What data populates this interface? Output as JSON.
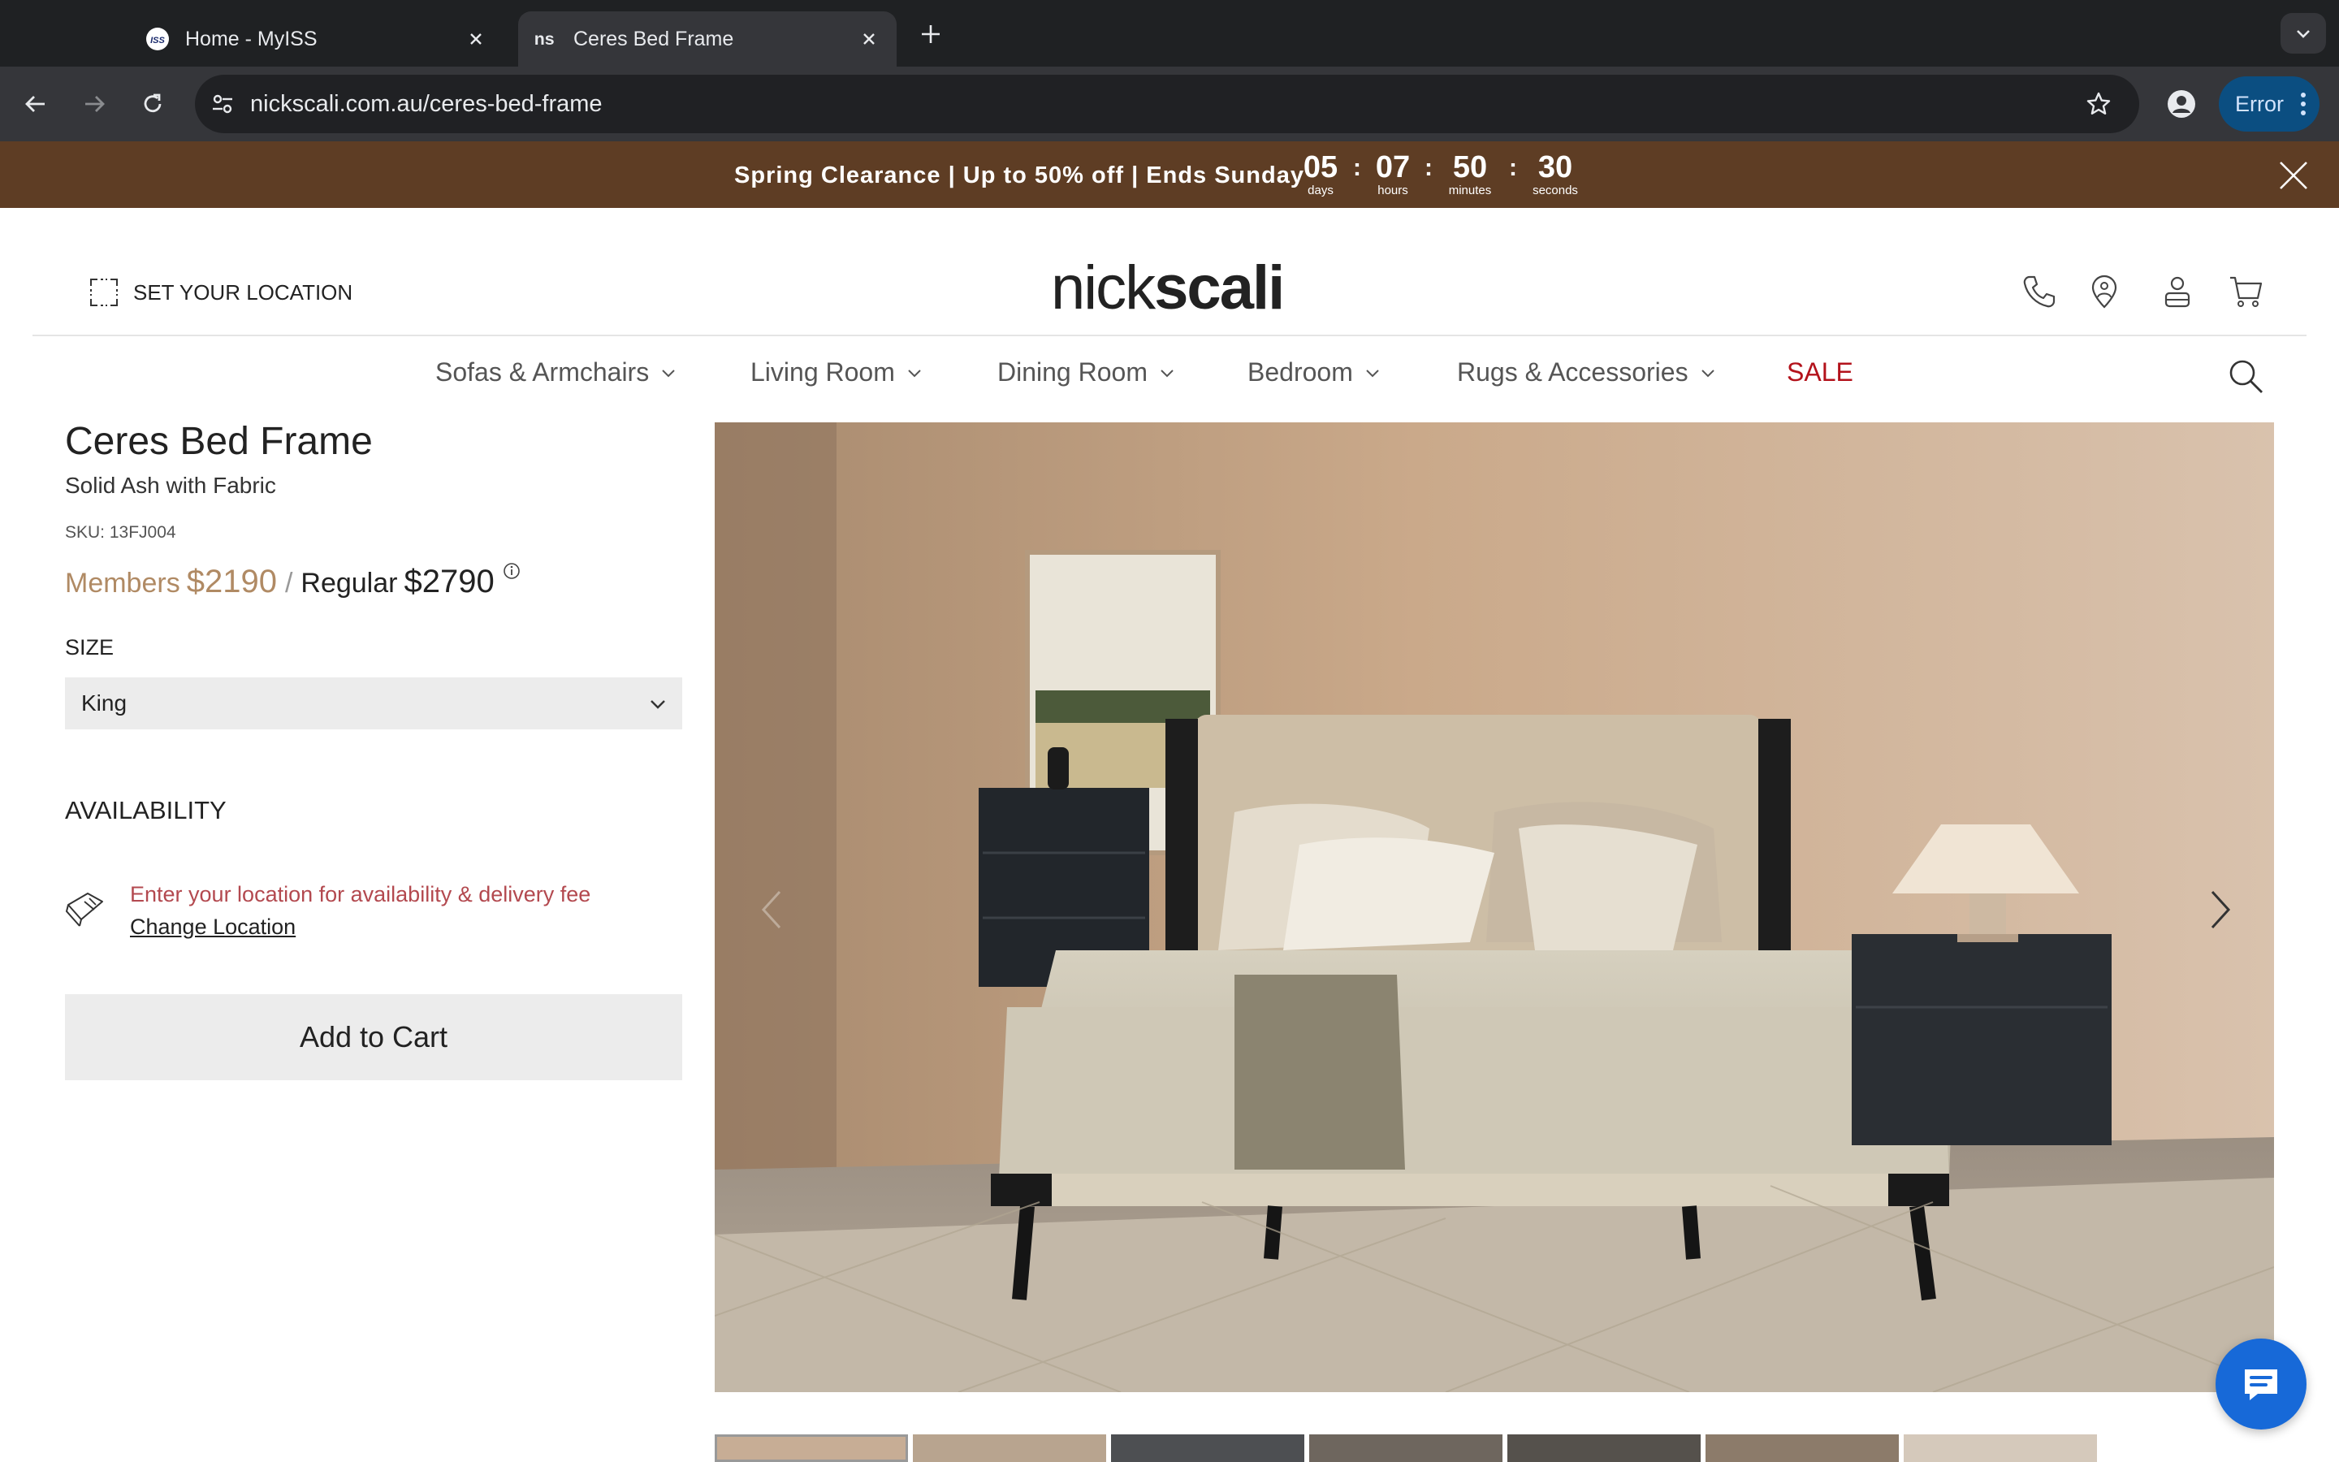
{
  "browser": {
    "tabs": [
      {
        "title": "Home - MyISS",
        "favicon": "iss-favicon",
        "active": false
      },
      {
        "title": "Ceres Bed Frame",
        "favicon": "ns-favicon",
        "active": true
      }
    ],
    "url": "nickscali.com.au/ceres-bed-frame",
    "profile_status": "Error",
    "favicon_iss_text": "ISS",
    "favicon_ns_text": "ns"
  },
  "promo": {
    "text": "Spring Clearance | Up to 50% off | Ends Sunday",
    "countdown": [
      {
        "value": "05",
        "label": "days"
      },
      {
        "value": "07",
        "label": "hours"
      },
      {
        "value": "50",
        "label": "minutes"
      },
      {
        "value": "30",
        "label": "seconds"
      }
    ],
    "bg_color": "#5e3d24"
  },
  "header": {
    "set_location": "SET YOUR LOCATION",
    "logo_light": "nick",
    "logo_bold": "scali",
    "icons": [
      "phone-icon",
      "store-locator-icon",
      "account-icon",
      "cart-icon"
    ]
  },
  "nav": {
    "items": [
      {
        "label": "Sofas & Armchairs"
      },
      {
        "label": "Living Room"
      },
      {
        "label": "Dining Room"
      },
      {
        "label": "Bedroom"
      },
      {
        "label": "Rugs & Accessories"
      },
      {
        "label": "SALE"
      }
    ],
    "sale_color": "#b3121b"
  },
  "product": {
    "title": "Ceres Bed Frame",
    "subtitle": "Solid Ash with Fabric",
    "sku": "SKU: 13FJ004",
    "members_label": "Members",
    "members_price": "$2190",
    "separator": "/",
    "regular_label": "Regular",
    "regular_price": "$2790",
    "size_label": "SIZE",
    "size_value": "King",
    "availability_label": "AVAILABILITY",
    "delivery_text": "Enter your location for availability & delivery fee",
    "change_location": "Change Location",
    "add_to_cart": "Add to Cart",
    "accent_color": "#b08a64"
  }
}
